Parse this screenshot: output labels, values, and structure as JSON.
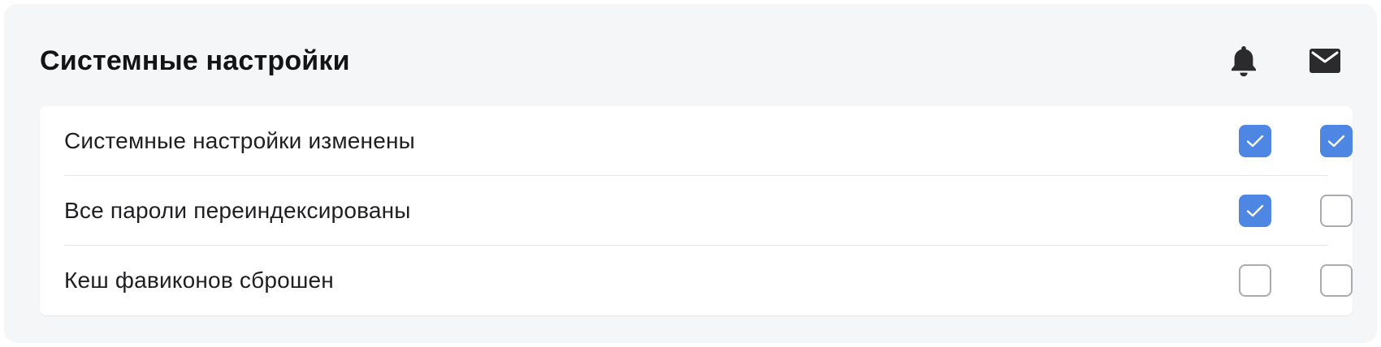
{
  "panel": {
    "title": "Системные настройки",
    "channels": [
      {
        "id": "push",
        "icon": "bell-icon"
      },
      {
        "id": "email",
        "icon": "mail-icon"
      }
    ]
  },
  "settings": [
    {
      "label": "Системные настройки изменены",
      "push": true,
      "email": true
    },
    {
      "label": "Все пароли переиндексированы",
      "push": true,
      "email": false
    },
    {
      "label": "Кеш фавиконов сброшен",
      "push": false,
      "email": false
    }
  ],
  "colors": {
    "accent": "#4d86e3",
    "panel_bg": "#f5f6f8",
    "checkbox_border": "#a9abb0",
    "divider": "#e6e7ea",
    "icon": "#2b2b2e"
  }
}
